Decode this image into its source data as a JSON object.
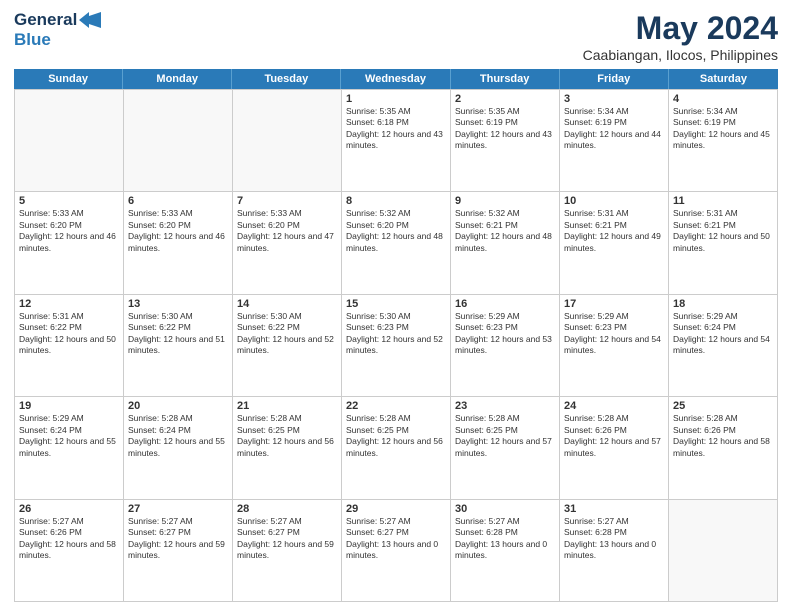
{
  "logo": {
    "line1": "General",
    "line2": "Blue"
  },
  "title": {
    "month_year": "May 2024",
    "location": "Caabiangan, Ilocos, Philippines"
  },
  "days_header": [
    "Sunday",
    "Monday",
    "Tuesday",
    "Wednesday",
    "Thursday",
    "Friday",
    "Saturday"
  ],
  "weeks": [
    [
      {
        "day": "",
        "sunrise": "",
        "sunset": "",
        "daylight": ""
      },
      {
        "day": "",
        "sunrise": "",
        "sunset": "",
        "daylight": ""
      },
      {
        "day": "",
        "sunrise": "",
        "sunset": "",
        "daylight": ""
      },
      {
        "day": "1",
        "sunrise": "Sunrise: 5:35 AM",
        "sunset": "Sunset: 6:18 PM",
        "daylight": "Daylight: 12 hours and 43 minutes."
      },
      {
        "day": "2",
        "sunrise": "Sunrise: 5:35 AM",
        "sunset": "Sunset: 6:19 PM",
        "daylight": "Daylight: 12 hours and 43 minutes."
      },
      {
        "day": "3",
        "sunrise": "Sunrise: 5:34 AM",
        "sunset": "Sunset: 6:19 PM",
        "daylight": "Daylight: 12 hours and 44 minutes."
      },
      {
        "day": "4",
        "sunrise": "Sunrise: 5:34 AM",
        "sunset": "Sunset: 6:19 PM",
        "daylight": "Daylight: 12 hours and 45 minutes."
      }
    ],
    [
      {
        "day": "5",
        "sunrise": "Sunrise: 5:33 AM",
        "sunset": "Sunset: 6:20 PM",
        "daylight": "Daylight: 12 hours and 46 minutes."
      },
      {
        "day": "6",
        "sunrise": "Sunrise: 5:33 AM",
        "sunset": "Sunset: 6:20 PM",
        "daylight": "Daylight: 12 hours and 46 minutes."
      },
      {
        "day": "7",
        "sunrise": "Sunrise: 5:33 AM",
        "sunset": "Sunset: 6:20 PM",
        "daylight": "Daylight: 12 hours and 47 minutes."
      },
      {
        "day": "8",
        "sunrise": "Sunrise: 5:32 AM",
        "sunset": "Sunset: 6:20 PM",
        "daylight": "Daylight: 12 hours and 48 minutes."
      },
      {
        "day": "9",
        "sunrise": "Sunrise: 5:32 AM",
        "sunset": "Sunset: 6:21 PM",
        "daylight": "Daylight: 12 hours and 48 minutes."
      },
      {
        "day": "10",
        "sunrise": "Sunrise: 5:31 AM",
        "sunset": "Sunset: 6:21 PM",
        "daylight": "Daylight: 12 hours and 49 minutes."
      },
      {
        "day": "11",
        "sunrise": "Sunrise: 5:31 AM",
        "sunset": "Sunset: 6:21 PM",
        "daylight": "Daylight: 12 hours and 50 minutes."
      }
    ],
    [
      {
        "day": "12",
        "sunrise": "Sunrise: 5:31 AM",
        "sunset": "Sunset: 6:22 PM",
        "daylight": "Daylight: 12 hours and 50 minutes."
      },
      {
        "day": "13",
        "sunrise": "Sunrise: 5:30 AM",
        "sunset": "Sunset: 6:22 PM",
        "daylight": "Daylight: 12 hours and 51 minutes."
      },
      {
        "day": "14",
        "sunrise": "Sunrise: 5:30 AM",
        "sunset": "Sunset: 6:22 PM",
        "daylight": "Daylight: 12 hours and 52 minutes."
      },
      {
        "day": "15",
        "sunrise": "Sunrise: 5:30 AM",
        "sunset": "Sunset: 6:23 PM",
        "daylight": "Daylight: 12 hours and 52 minutes."
      },
      {
        "day": "16",
        "sunrise": "Sunrise: 5:29 AM",
        "sunset": "Sunset: 6:23 PM",
        "daylight": "Daylight: 12 hours and 53 minutes."
      },
      {
        "day": "17",
        "sunrise": "Sunrise: 5:29 AM",
        "sunset": "Sunset: 6:23 PM",
        "daylight": "Daylight: 12 hours and 54 minutes."
      },
      {
        "day": "18",
        "sunrise": "Sunrise: 5:29 AM",
        "sunset": "Sunset: 6:24 PM",
        "daylight": "Daylight: 12 hours and 54 minutes."
      }
    ],
    [
      {
        "day": "19",
        "sunrise": "Sunrise: 5:29 AM",
        "sunset": "Sunset: 6:24 PM",
        "daylight": "Daylight: 12 hours and 55 minutes."
      },
      {
        "day": "20",
        "sunrise": "Sunrise: 5:28 AM",
        "sunset": "Sunset: 6:24 PM",
        "daylight": "Daylight: 12 hours and 55 minutes."
      },
      {
        "day": "21",
        "sunrise": "Sunrise: 5:28 AM",
        "sunset": "Sunset: 6:25 PM",
        "daylight": "Daylight: 12 hours and 56 minutes."
      },
      {
        "day": "22",
        "sunrise": "Sunrise: 5:28 AM",
        "sunset": "Sunset: 6:25 PM",
        "daylight": "Daylight: 12 hours and 56 minutes."
      },
      {
        "day": "23",
        "sunrise": "Sunrise: 5:28 AM",
        "sunset": "Sunset: 6:25 PM",
        "daylight": "Daylight: 12 hours and 57 minutes."
      },
      {
        "day": "24",
        "sunrise": "Sunrise: 5:28 AM",
        "sunset": "Sunset: 6:26 PM",
        "daylight": "Daylight: 12 hours and 57 minutes."
      },
      {
        "day": "25",
        "sunrise": "Sunrise: 5:28 AM",
        "sunset": "Sunset: 6:26 PM",
        "daylight": "Daylight: 12 hours and 58 minutes."
      }
    ],
    [
      {
        "day": "26",
        "sunrise": "Sunrise: 5:27 AM",
        "sunset": "Sunset: 6:26 PM",
        "daylight": "Daylight: 12 hours and 58 minutes."
      },
      {
        "day": "27",
        "sunrise": "Sunrise: 5:27 AM",
        "sunset": "Sunset: 6:27 PM",
        "daylight": "Daylight: 12 hours and 59 minutes."
      },
      {
        "day": "28",
        "sunrise": "Sunrise: 5:27 AM",
        "sunset": "Sunset: 6:27 PM",
        "daylight": "Daylight: 12 hours and 59 minutes."
      },
      {
        "day": "29",
        "sunrise": "Sunrise: 5:27 AM",
        "sunset": "Sunset: 6:27 PM",
        "daylight": "Daylight: 13 hours and 0 minutes."
      },
      {
        "day": "30",
        "sunrise": "Sunrise: 5:27 AM",
        "sunset": "Sunset: 6:28 PM",
        "daylight": "Daylight: 13 hours and 0 minutes."
      },
      {
        "day": "31",
        "sunrise": "Sunrise: 5:27 AM",
        "sunset": "Sunset: 6:28 PM",
        "daylight": "Daylight: 13 hours and 0 minutes."
      },
      {
        "day": "",
        "sunrise": "",
        "sunset": "",
        "daylight": ""
      }
    ]
  ]
}
